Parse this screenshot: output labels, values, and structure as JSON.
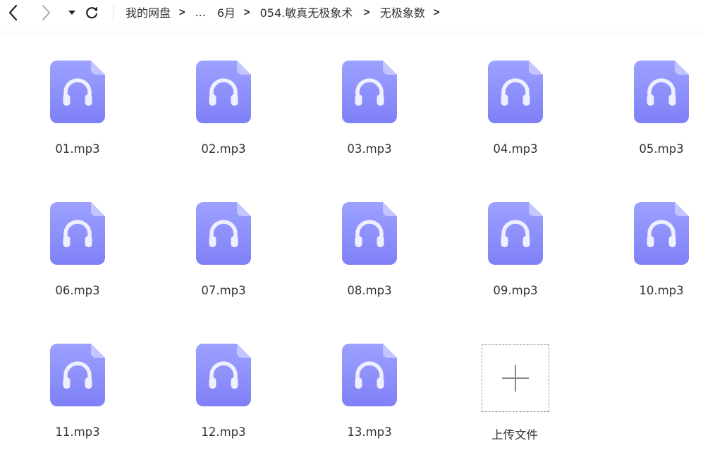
{
  "toolbar": {
    "back_icon": "chevron-left-icon",
    "forward_icon": "chevron-right-icon",
    "menu_icon": "caret-down-icon",
    "refresh_icon": "refresh-icon",
    "breadcrumb": [
      "我的网盘",
      "...",
      "6月",
      "054.敏真无极象术",
      "无极象数"
    ],
    "crumb_separator": ">"
  },
  "files": [
    {
      "name": "01.mp3",
      "icon": "audio-file-icon"
    },
    {
      "name": "02.mp3",
      "icon": "audio-file-icon"
    },
    {
      "name": "03.mp3",
      "icon": "audio-file-icon"
    },
    {
      "name": "04.mp3",
      "icon": "audio-file-icon"
    },
    {
      "name": "05.mp3",
      "icon": "audio-file-icon"
    },
    {
      "name": "06.mp3",
      "icon": "audio-file-icon"
    },
    {
      "name": "07.mp3",
      "icon": "audio-file-icon"
    },
    {
      "name": "08.mp3",
      "icon": "audio-file-icon"
    },
    {
      "name": "09.mp3",
      "icon": "audio-file-icon"
    },
    {
      "name": "10.mp3",
      "icon": "audio-file-icon"
    },
    {
      "name": "11.mp3",
      "icon": "audio-file-icon"
    },
    {
      "name": "12.mp3",
      "icon": "audio-file-icon"
    },
    {
      "name": "13.mp3",
      "icon": "audio-file-icon"
    }
  ],
  "upload": {
    "label": "上传文件",
    "icon": "plus-icon"
  },
  "colors": {
    "file_icon_top": "#9da1ff",
    "file_icon_bottom": "#7f80f7",
    "file_icon_fold": "#c3c5ff",
    "headphone": "#eef0ff"
  }
}
